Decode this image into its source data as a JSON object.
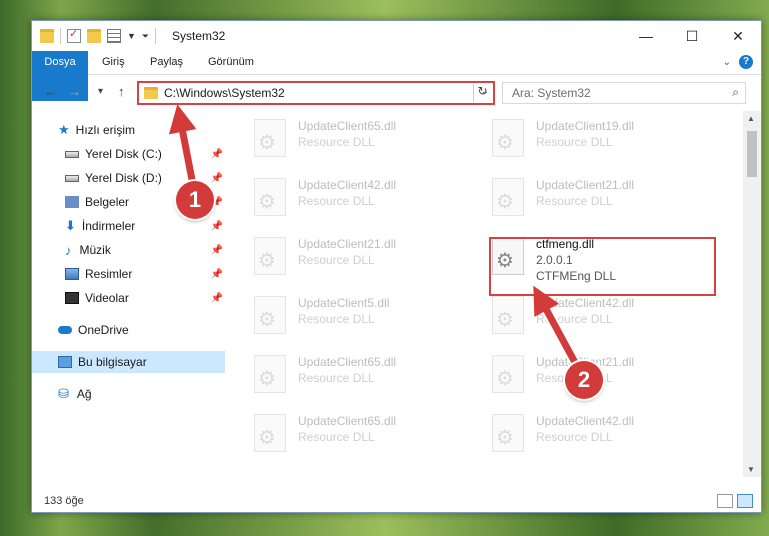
{
  "window": {
    "title": "System32",
    "controls": {
      "minimize": "—",
      "maximize": "☐",
      "close": "✕"
    }
  },
  "ribbon": {
    "tabs": [
      "Dosya",
      "Giriş",
      "Paylaş",
      "Görünüm"
    ],
    "help": "?"
  },
  "navigation": {
    "back": "←",
    "forward": "→",
    "recent": "▾",
    "up": "↑",
    "address": "C:\\Windows\\System32",
    "refresh": "↻",
    "search_placeholder": "Ara: System32",
    "search_icon": "search-icon"
  },
  "sidebar": {
    "items": [
      {
        "label": "Hızlı erişim",
        "icon": "star-icon",
        "pinned": false,
        "selected": false
      },
      {
        "label": "Yerel Disk (C:)",
        "icon": "disk-icon",
        "pinned": true,
        "selected": false
      },
      {
        "label": "Yerel Disk (D:)",
        "icon": "disk-icon",
        "pinned": true,
        "selected": false
      },
      {
        "label": "Belgeler",
        "icon": "documents-icon",
        "pinned": true,
        "selected": false
      },
      {
        "label": "İndirmeler",
        "icon": "download-icon",
        "pinned": true,
        "selected": false
      },
      {
        "label": "Müzik",
        "icon": "music-icon",
        "pinned": true,
        "selected": false
      },
      {
        "label": "Resimler",
        "icon": "pictures-icon",
        "pinned": true,
        "selected": false
      },
      {
        "label": "Videolar",
        "icon": "videos-icon",
        "pinned": true,
        "selected": false
      },
      {
        "label": "OneDrive",
        "icon": "onedrive-icon",
        "pinned": false,
        "selected": false
      },
      {
        "label": "Bu bilgisayar",
        "icon": "this-pc-icon",
        "pinned": false,
        "selected": true
      },
      {
        "label": "Ağ",
        "icon": "network-icon",
        "pinned": false,
        "selected": false
      }
    ]
  },
  "files": [
    {
      "name": "UpdateClient65.dll",
      "desc": "Resource DLL"
    },
    {
      "name": "UpdateClient19.dll",
      "desc": "Resource DLL"
    },
    {
      "name": "UpdateClient42.dll",
      "desc": "Resource DLL"
    },
    {
      "name": "UpdateClient21.dll",
      "desc": "Resource DLL"
    },
    {
      "name": "UpdateClient21.dll",
      "desc": "Resource DLL"
    },
    {
      "name": "ctfmeng.dll",
      "version": "2.0.0.1",
      "desc": "CTFMEng DLL",
      "highlighted": true
    },
    {
      "name": "UpdateClient5.dll",
      "desc": "Resource DLL"
    },
    {
      "name": "UpdateClient42.dll",
      "desc": "Resource DLL"
    },
    {
      "name": "UpdateClient65.dll",
      "desc": "Resource DLL"
    },
    {
      "name": "UpdateClient21.dll",
      "desc": "Resource DLL"
    },
    {
      "name": "UpdateClient65.dll",
      "desc": "Resource DLL"
    },
    {
      "name": "UpdateClient42.dll",
      "desc": "Resource DLL"
    }
  ],
  "status": {
    "count": "133 öğe"
  },
  "annotations": {
    "badge1": "1",
    "badge2": "2",
    "color": "#d33a3a"
  }
}
